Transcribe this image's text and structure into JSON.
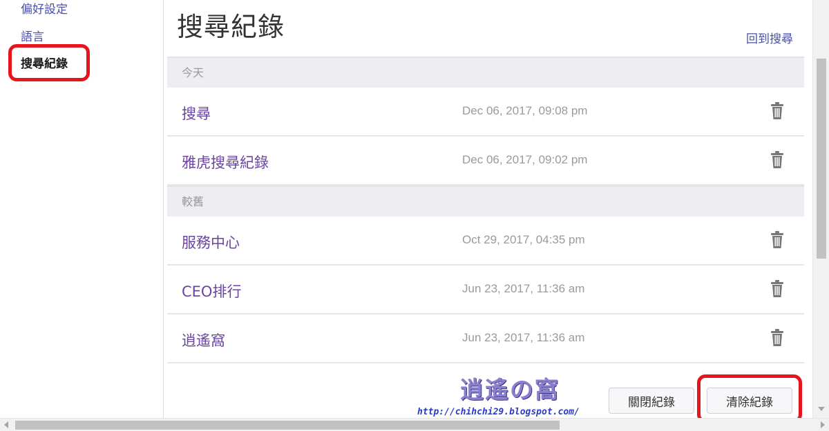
{
  "sidebar": {
    "items": [
      {
        "label": "偏好設定",
        "active": false
      },
      {
        "label": "語言",
        "active": false
      },
      {
        "label": "搜尋紀錄",
        "active": true
      }
    ]
  },
  "header": {
    "title": "搜尋紀錄",
    "back_link": "回到搜尋"
  },
  "sections": [
    {
      "label": "今天",
      "entries": [
        {
          "query": "搜尋",
          "date": "Dec 06, 2017, 09:08 pm",
          "delete_icon": "trash-icon"
        },
        {
          "query": "雅虎搜尋紀錄",
          "date": "Dec 06, 2017, 09:02 pm",
          "delete_icon": "trash-icon"
        }
      ]
    },
    {
      "label": "較舊",
      "entries": [
        {
          "query": "服務中心",
          "date": "Oct 29, 2017, 04:35 pm",
          "delete_icon": "trash-icon"
        },
        {
          "query": "CEO排行",
          "date": "Jun 23, 2017, 11:36 am",
          "delete_icon": "trash-icon"
        },
        {
          "query": "逍遙窩",
          "date": "Jun 23, 2017, 11:36 am",
          "delete_icon": "trash-icon"
        }
      ]
    }
  ],
  "footer": {
    "close_history_label": "關閉紀錄",
    "clear_history_label": "清除紀錄"
  },
  "watermark": {
    "title": "逍遙の窩",
    "url": "http://chihchi29.blogspot.com/"
  },
  "colors": {
    "link": "#4a4fa8",
    "query": "#6b43a3",
    "highlight": "#e8141c",
    "muted": "#9a9a9a"
  }
}
